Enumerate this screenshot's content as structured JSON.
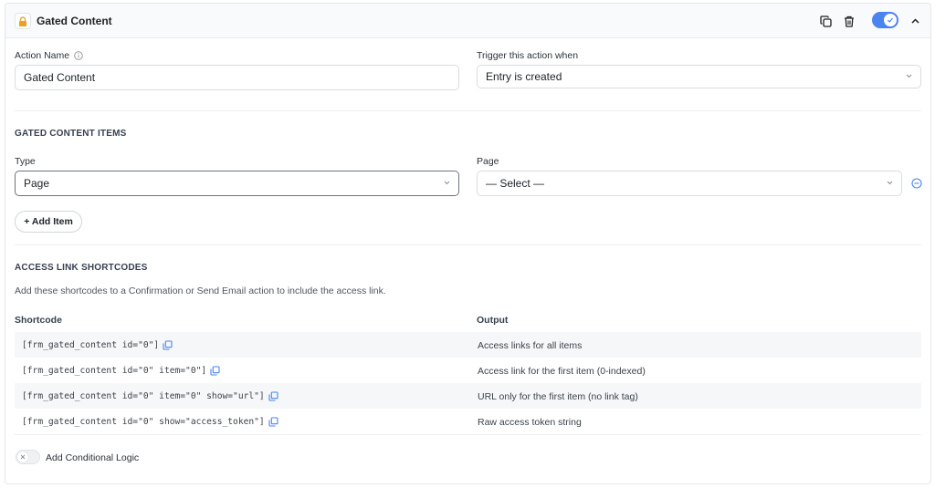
{
  "header": {
    "title": "Gated Content",
    "icons": [
      "lock-icon",
      "duplicate-icon",
      "trash-icon",
      "toggle-check-icon",
      "chevron-up-icon"
    ],
    "enabled": true
  },
  "action_name": {
    "label": "Action Name",
    "value": "Gated Content"
  },
  "trigger": {
    "label": "Trigger this action when",
    "value": "Entry is created"
  },
  "gated_items": {
    "section_title": "GATED CONTENT ITEMS",
    "type_label": "Type",
    "type_value": "Page",
    "page_label": "Page",
    "page_value": "— Select —",
    "add_button": "+ Add Item"
  },
  "shortcodes": {
    "section_title": "ACCESS LINK SHORTCODES",
    "description": "Add these shortcodes to a Confirmation or Send Email action to include the access link.",
    "col_shortcode": "Shortcode",
    "col_output": "Output",
    "rows": [
      {
        "code": "[frm_gated_content id=\"0\"]",
        "output": "Access links for all items"
      },
      {
        "code": "[frm_gated_content id=\"0\" item=\"0\"]",
        "output": "Access link for the first item (0-indexed)"
      },
      {
        "code": "[frm_gated_content id=\"0\" item=\"0\" show=\"url\"]",
        "output": "URL only for the first item (no link tag)"
      },
      {
        "code": "[frm_gated_content id=\"0\" show=\"access_token\"]",
        "output": "Raw access token string"
      }
    ]
  },
  "conditional": {
    "label": "Add Conditional Logic",
    "enabled": false
  },
  "colors": {
    "accent": "#4b83f0",
    "lock": "#f0a020"
  }
}
